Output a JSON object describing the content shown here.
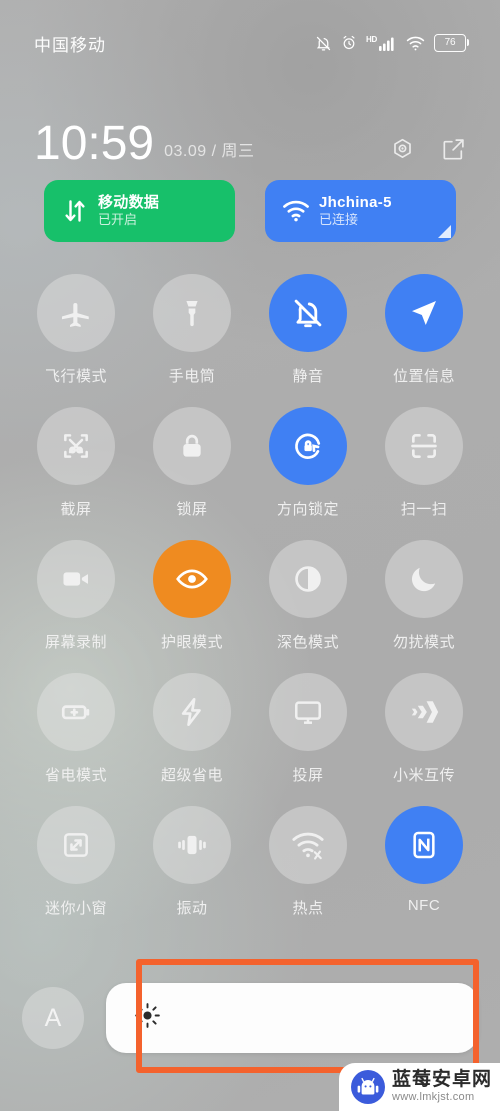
{
  "status_bar": {
    "carrier": "中国移动",
    "battery_percent": "76",
    "hd_label": "HD",
    "icons": [
      "bell-slash-icon",
      "alarm-icon",
      "signal-bars-icon",
      "wifi-icon",
      "battery-icon"
    ]
  },
  "header": {
    "time": "10:59",
    "date": "03.09 / 周三",
    "settings_icon": "gear-icon",
    "edit_icon": "edit-icon"
  },
  "cards": [
    {
      "title": "移动数据",
      "subtitle": "已开启",
      "icon": "mobile-data-icon",
      "color": "#17c06a",
      "state": "on"
    },
    {
      "title": "Jhchina-5",
      "subtitle": "已连接",
      "icon": "wifi-icon",
      "color": "#4080f3",
      "state": "on",
      "expand": true
    }
  ],
  "toggles": [
    {
      "label": "飞行模式",
      "icon": "airplane-icon",
      "state": "off"
    },
    {
      "label": "手电筒",
      "icon": "flashlight-icon",
      "state": "off"
    },
    {
      "label": "静音",
      "icon": "bell-slash-icon",
      "state": "on",
      "accent": "#4080f3"
    },
    {
      "label": "位置信息",
      "icon": "location-arrow-icon",
      "state": "on",
      "accent": "#4080f3"
    },
    {
      "label": "截屏",
      "icon": "screenshot-icon",
      "state": "off"
    },
    {
      "label": "锁屏",
      "icon": "lock-icon",
      "state": "off"
    },
    {
      "label": "方向锁定",
      "icon": "rotation-lock-icon",
      "state": "on",
      "accent": "#4080f3"
    },
    {
      "label": "扫一扫",
      "icon": "scan-icon",
      "state": "off"
    },
    {
      "label": "屏幕录制",
      "icon": "video-camera-icon",
      "state": "off"
    },
    {
      "label": "护眼模式",
      "icon": "eye-icon",
      "state": "on",
      "accent": "#ef8b20"
    },
    {
      "label": "深色模式",
      "icon": "contrast-icon",
      "state": "off"
    },
    {
      "label": "勿扰模式",
      "icon": "moon-icon",
      "state": "off"
    },
    {
      "label": "省电模式",
      "icon": "battery-saver-icon",
      "state": "off"
    },
    {
      "label": "超级省电",
      "icon": "lightning-icon",
      "state": "off"
    },
    {
      "label": "投屏",
      "icon": "cast-screen-icon",
      "state": "off"
    },
    {
      "label": "小米互传",
      "icon": "mi-share-icon",
      "state": "off"
    },
    {
      "label": "迷你小窗",
      "icon": "mini-window-icon",
      "state": "off"
    },
    {
      "label": "振动",
      "icon": "vibrate-icon",
      "state": "off"
    },
    {
      "label": "热点",
      "icon": "hotspot-icon",
      "state": "off"
    },
    {
      "label": "NFC",
      "icon": "nfc-icon",
      "state": "on",
      "accent": "#4080f3"
    }
  ],
  "brightness": {
    "auto_label": "A",
    "slider_icon": "sun-icon",
    "fill_percent": 15,
    "highlight_color": "#f4622d"
  },
  "watermark": {
    "title": "蓝莓安卓网",
    "url": "www.lmkjst.com",
    "logo_icon": "android-robot-icon"
  }
}
